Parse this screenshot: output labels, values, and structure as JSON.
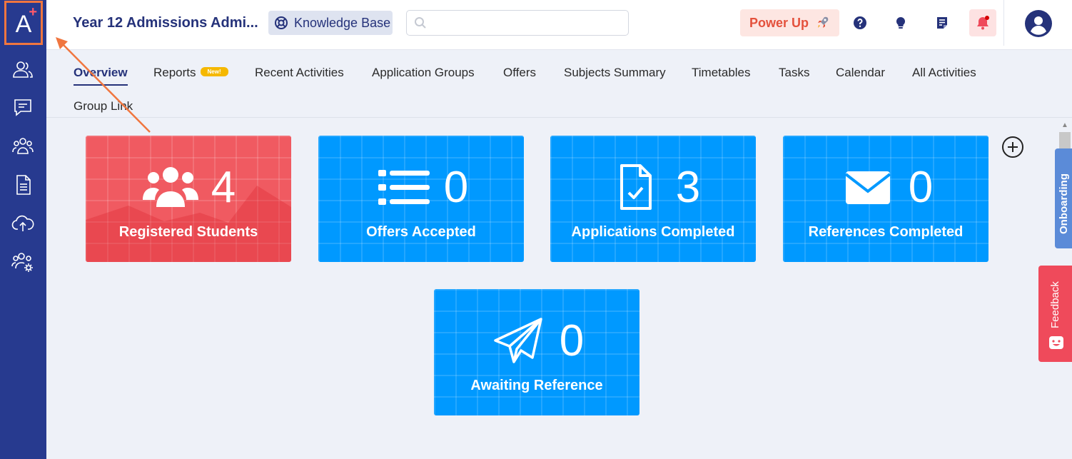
{
  "logo": {
    "letter": "A",
    "plus": "+"
  },
  "sidebar": {
    "items": [
      {
        "name": "users-icon"
      },
      {
        "name": "chat-icon"
      },
      {
        "name": "group-icon"
      },
      {
        "name": "document-icon"
      },
      {
        "name": "cloud-upload-icon"
      },
      {
        "name": "group-settings-icon"
      }
    ]
  },
  "header": {
    "title": "Year 12 Admissions Admi...",
    "knowledge_base": "Knowledge Base",
    "search_placeholder": "",
    "power_up": "Power Up",
    "icons": [
      "help-icon",
      "lightbulb-icon",
      "notes-icon",
      "bell-icon",
      "avatar-icon"
    ]
  },
  "tabs": [
    {
      "label": "Overview",
      "active": true
    },
    {
      "label": "Reports",
      "badge": "New!"
    },
    {
      "label": "Recent Activities"
    },
    {
      "label": "Application Groups"
    },
    {
      "label": "Offers"
    },
    {
      "label": "Subjects Summary"
    },
    {
      "label": "Timetables"
    },
    {
      "label": "Tasks"
    },
    {
      "label": "Calendar"
    },
    {
      "label": "All Activities"
    },
    {
      "label": "Group Link"
    }
  ],
  "cards": [
    {
      "value": "4",
      "label": "Registered Students",
      "color": "#f05a61",
      "icon": "students-icon"
    },
    {
      "value": "0",
      "label": "Offers Accepted",
      "color": "#0099ff",
      "icon": "list-icon"
    },
    {
      "value": "3",
      "label": "Applications Completed",
      "color": "#0099ff",
      "icon": "file-check-icon"
    },
    {
      "value": "0",
      "label": "References Completed",
      "color": "#0099ff",
      "icon": "envelope-icon"
    },
    {
      "value": "0",
      "label": "Awaiting Reference",
      "color": "#0099ff",
      "icon": "paper-plane-icon"
    }
  ],
  "side_tabs": {
    "onboarding": "Onboarding",
    "feedback": "Feedback"
  },
  "colors": {
    "sidebar": "#273a8f",
    "accent": "#25327a",
    "card_blue": "#0099ff",
    "card_red": "#f05a61",
    "highlight": "#f0763f"
  }
}
